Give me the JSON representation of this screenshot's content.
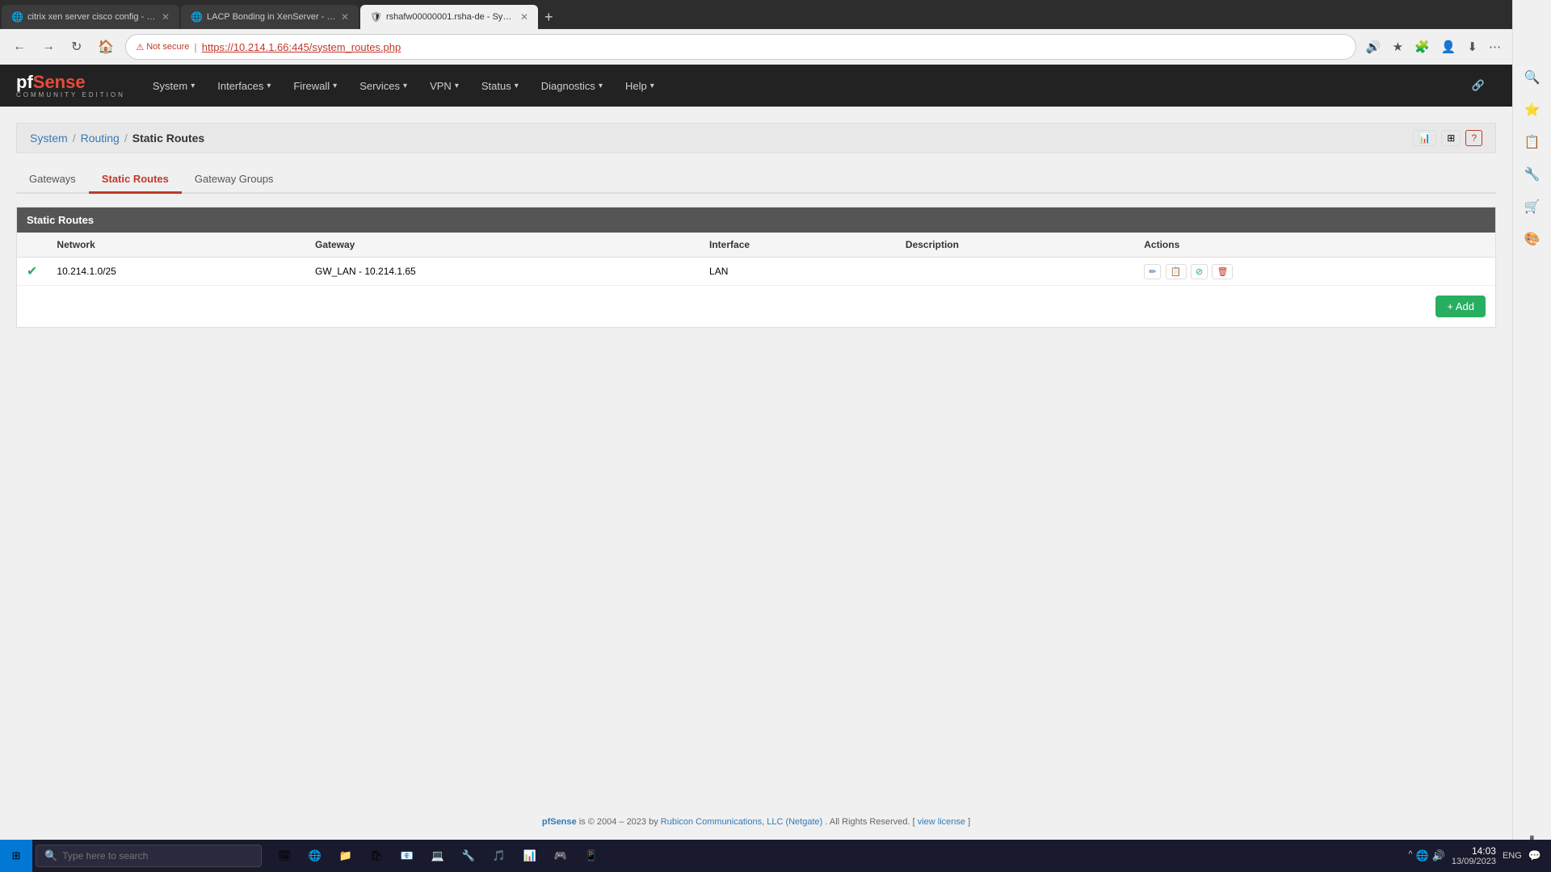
{
  "browser": {
    "tabs": [
      {
        "id": "tab1",
        "title": "citrix xen server cisco config - Se...",
        "active": false,
        "favicon": "🌐"
      },
      {
        "id": "tab2",
        "title": "LACP Bonding in XenServer - Co...",
        "active": false,
        "favicon": "🌐"
      },
      {
        "id": "tab3",
        "title": "rshafw00000001.rsha-de - Syst...",
        "active": true,
        "favicon": "🛡"
      }
    ],
    "address": "https://10.214.1.66:445/system_routes.php",
    "not_secure_label": "Not secure"
  },
  "nav": {
    "logo": "pf",
    "logo_sub": "COMMUNITY EDITION",
    "items": [
      {
        "label": "System",
        "has_dropdown": true
      },
      {
        "label": "Interfaces",
        "has_dropdown": true
      },
      {
        "label": "Firewall",
        "has_dropdown": true
      },
      {
        "label": "Services",
        "has_dropdown": true
      },
      {
        "label": "VPN",
        "has_dropdown": true
      },
      {
        "label": "Status",
        "has_dropdown": true
      },
      {
        "label": "Diagnostics",
        "has_dropdown": true
      },
      {
        "label": "Help",
        "has_dropdown": true
      }
    ]
  },
  "breadcrumb": {
    "items": [
      {
        "label": "System",
        "href": "#"
      },
      {
        "label": "Routing",
        "href": "#"
      },
      {
        "label": "Static Routes",
        "href": null
      }
    ]
  },
  "tabs": [
    {
      "label": "Gateways",
      "active": false
    },
    {
      "label": "Static Routes",
      "active": true
    },
    {
      "label": "Gateway Groups",
      "active": false
    }
  ],
  "table": {
    "header": "Static Routes",
    "columns": [
      "Network",
      "Gateway",
      "Interface",
      "Description",
      "Actions"
    ],
    "rows": [
      {
        "status": "active",
        "network": "10.214.1.0/25",
        "gateway": "GW_LAN - 10.214.1.65",
        "interface": "LAN",
        "description": ""
      }
    ]
  },
  "buttons": {
    "add": "+ Add"
  },
  "footer": {
    "text": "pfSense",
    "middle": " is © 2004 – 2023 by ",
    "company": "Rubicon Communications, LLC (Netgate)",
    "rights": ". All Rights Reserved. [",
    "license_link": "view license",
    "end": "]"
  },
  "taskbar": {
    "search_placeholder": "Type here to search",
    "clock": "14:03",
    "date": "13/09/2023",
    "lang": "ENG"
  }
}
